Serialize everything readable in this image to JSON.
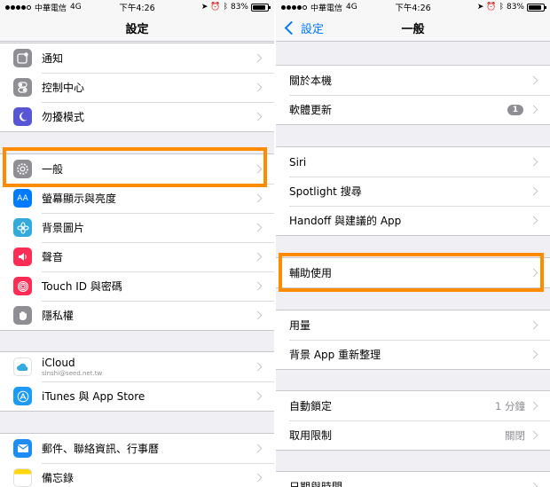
{
  "status": {
    "carrier": "中華電信",
    "network": "4G",
    "time": "下午4:26",
    "battery": "83%"
  },
  "left": {
    "title": "設定",
    "groups": [
      [
        {
          "label": "通知",
          "icon": "notifications-icon"
        },
        {
          "label": "控制中心",
          "icon": "control-center-icon"
        },
        {
          "label": "勿擾模式",
          "icon": "moon-icon"
        }
      ],
      [
        {
          "label": "一般",
          "icon": "gear-icon"
        },
        {
          "label": "螢幕顯示與亮度",
          "icon": "display-brightness-icon"
        },
        {
          "label": "背景圖片",
          "icon": "wallpaper-icon"
        },
        {
          "label": "聲音",
          "icon": "sound-icon"
        },
        {
          "label": "Touch ID 與密碼",
          "icon": "fingerprint-icon"
        },
        {
          "label": "隱私權",
          "icon": "privacy-hand-icon"
        }
      ],
      [
        {
          "label": "iCloud",
          "sub": "sinshi@seed.net.tw",
          "icon": "icloud-icon"
        },
        {
          "label": "iTunes 與 App Store",
          "icon": "app-store-icon"
        }
      ],
      [
        {
          "label": "郵件、聯絡資訊、行事曆",
          "icon": "mail-icon"
        },
        {
          "label": "備忘錄",
          "icon": "notes-icon"
        }
      ]
    ]
  },
  "right": {
    "back": "設定",
    "title": "一般",
    "groups": [
      [
        {
          "label": "關於本機"
        },
        {
          "label": "軟體更新",
          "badge": "1"
        }
      ],
      [
        {
          "label": "Siri"
        },
        {
          "label": "Spotlight 搜尋"
        },
        {
          "label": "Handoff 與建議的 App"
        }
      ],
      [
        {
          "label": "輔助使用"
        }
      ],
      [
        {
          "label": "用量"
        },
        {
          "label": "背景 App 重新整理"
        }
      ],
      [
        {
          "label": "自動鎖定",
          "value": "1 分鐘"
        },
        {
          "label": "取用限制",
          "value": "關閉"
        }
      ],
      [
        {
          "label": "日期與時間"
        }
      ]
    ]
  },
  "colors": {
    "highlight": "#ff8c00",
    "ios_blue": "#007aff"
  }
}
